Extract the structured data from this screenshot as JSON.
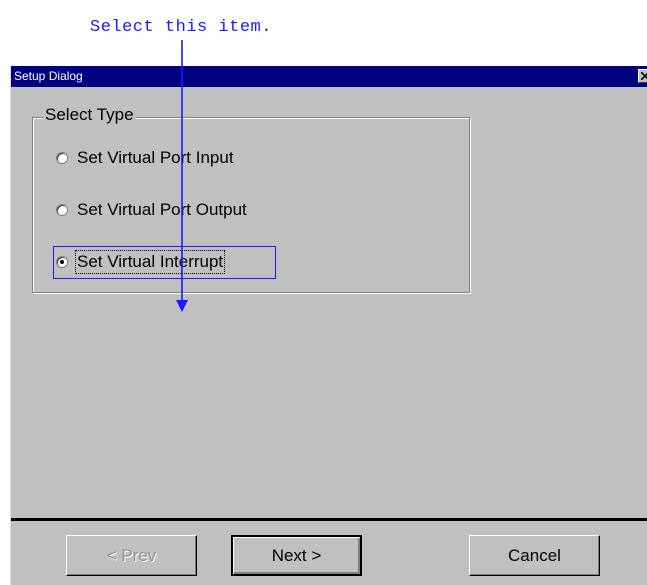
{
  "annotation": {
    "text": "Select this item."
  },
  "window": {
    "title": "Setup Dialog"
  },
  "group": {
    "legend": "Select Type",
    "options": [
      {
        "label": "Set Virtual Port Input",
        "selected": false
      },
      {
        "label": "Set Virtual Port Output",
        "selected": false
      },
      {
        "label": "Set Virtual Interrupt",
        "selected": true
      }
    ]
  },
  "buttons": {
    "prev": "< Prev",
    "next": "Next >",
    "cancel": "Cancel"
  },
  "colors": {
    "annotation": "#1a1aff",
    "title_bar": "#000080",
    "face": "#c0c0c0"
  },
  "icons": {
    "close": "close-icon",
    "arrow": "arrow-down-icon"
  }
}
